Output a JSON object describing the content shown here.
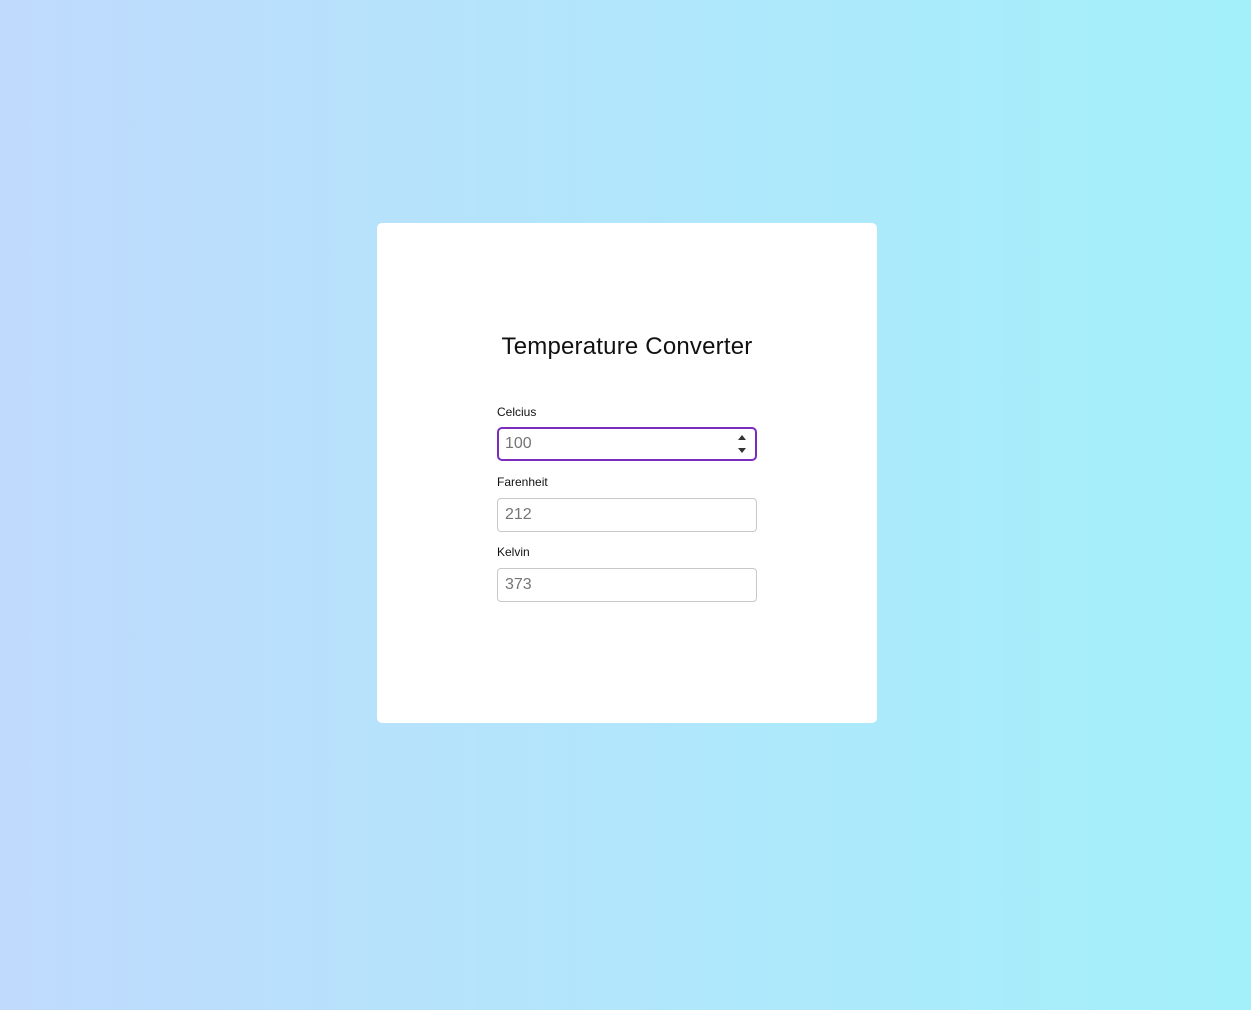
{
  "app": {
    "title": "Temperature Converter"
  },
  "fields": {
    "celcius": {
      "label": "Celcius",
      "placeholder": "100",
      "value": ""
    },
    "farenheit": {
      "label": "Farenheit",
      "placeholder": "212",
      "value": ""
    },
    "kelvin": {
      "label": "Kelvin",
      "placeholder": "373",
      "value": ""
    }
  },
  "colors": {
    "focus_border": "#7b2cbf",
    "background_left": "#c0dafd",
    "background_right": "#a3f0fa"
  },
  "icons": {
    "spinner_up": "caret-up-icon",
    "spinner_down": "caret-down-icon"
  }
}
